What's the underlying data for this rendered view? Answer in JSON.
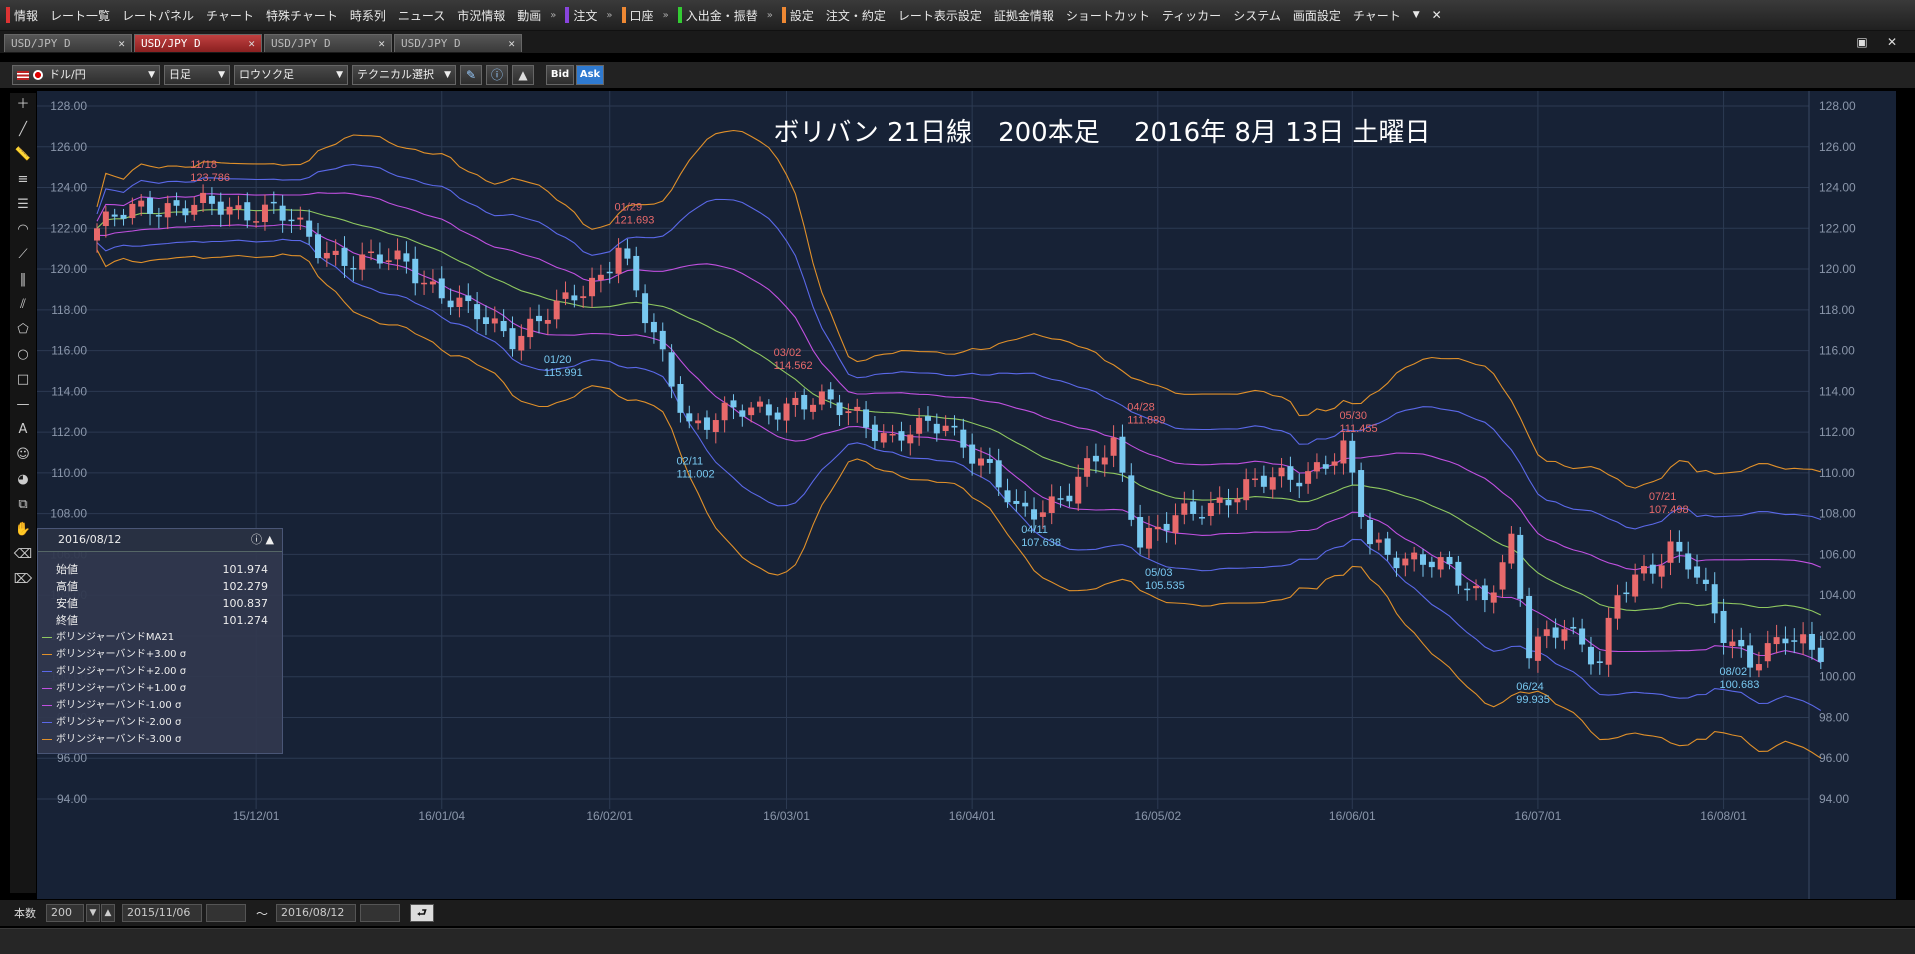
{
  "menubar": {
    "items": [
      {
        "label": "情報",
        "bar": "#d33"
      },
      {
        "label": "レート一覧"
      },
      {
        "label": "レートパネル"
      },
      {
        "label": "チャート"
      },
      {
        "label": "特殊チャート"
      },
      {
        "label": "時系列"
      },
      {
        "label": "ニュース"
      },
      {
        "label": "市況情報"
      },
      {
        "label": "動画"
      },
      {
        "label": "注文",
        "bar": "#84d",
        "sep": true
      },
      {
        "label": "口座",
        "bar": "#e83",
        "sep": true
      },
      {
        "label": "入出金・振替",
        "bar": "#3c3",
        "sep": true
      },
      {
        "label": "設定",
        "bar": "#e83",
        "sep": true
      },
      {
        "label": "注文・約定"
      },
      {
        "label": "レート表示設定"
      },
      {
        "label": "証拠金情報"
      },
      {
        "label": "ショートカット"
      },
      {
        "label": "ティッカー"
      },
      {
        "label": "システム"
      },
      {
        "label": "画面設定"
      },
      {
        "label": "チャート"
      }
    ],
    "dropdown_glyph": "▼",
    "close_glyph": "✕"
  },
  "tabs": [
    {
      "label": "USD/JPY D",
      "active": false
    },
    {
      "label": "USD/JPY D",
      "active": true
    },
    {
      "label": "USD/JPY D",
      "active": false
    },
    {
      "label": "USD/JPY D",
      "active": false
    }
  ],
  "tab_close": "✕",
  "window_buttons": {
    "restore": "▣",
    "close": "✕"
  },
  "toolbar": {
    "pair": "ドル/円",
    "period": "日足",
    "chart_type": "ロウソク足",
    "technical": "テクニカル選択",
    "bid": "Bid",
    "ask": "Ask"
  },
  "bottom": {
    "count_label": "本数",
    "count_value": "200",
    "from_date": "2015/11/06",
    "tilde": "〜",
    "to_date": "2016/08/12",
    "back_glyph": "⮐"
  },
  "info_panel": {
    "date": "2016/08/12",
    "rows": [
      {
        "label": "始値",
        "value": "101.974"
      },
      {
        "label": "高値",
        "value": "102.279"
      },
      {
        "label": "安値",
        "value": "100.837"
      },
      {
        "label": "終値",
        "value": "101.274"
      }
    ],
    "legend": [
      {
        "label": "ボリンジャーバンドMA21",
        "color": "#8fc860"
      },
      {
        "label": "ボリンジャーバンド+3.00 σ",
        "color": "#e0902a"
      },
      {
        "label": "ボリンジャーバンド+2.00 σ",
        "color": "#5a68e8"
      },
      {
        "label": "ボリンジャーバンド+1.00 σ",
        "color": "#c050e0"
      },
      {
        "label": "ボリンジャーバンド-1.00 σ",
        "color": "#c050e0"
      },
      {
        "label": "ボリンジャーバンド-2.00 σ",
        "color": "#5a68e8"
      },
      {
        "label": "ボリンジャーバンド-3.00 σ",
        "color": "#e0902a"
      }
    ]
  },
  "colors": {
    "chart_bg": "#172236",
    "grid": "#2c3a52",
    "up": "#e8696b",
    "down": "#78c8f0",
    "ma": "#8fc860",
    "band3": "#e0902a",
    "band2": "#5a68e8",
    "band1": "#c050e0",
    "axis_text": "#8a96aa",
    "annot_high": "#e8696b",
    "annot_low": "#78c8f0"
  },
  "chart_data": {
    "type": "candlestick",
    "title": "ボリバン 21日線　200本足　 2016年 8月 13日 土曜日",
    "ylim": [
      94,
      128
    ],
    "yticks": [
      "94.00",
      "96.00",
      "98.00",
      "100.00",
      "102.00",
      "104.00",
      "106.00",
      "108.00",
      "110.00",
      "112.00",
      "114.00",
      "116.00",
      "118.00",
      "120.00",
      "122.00",
      "124.00",
      "126.00",
      "128.00"
    ],
    "xtick_labels": [
      "15/12/01",
      "16/01/04",
      "16/02/01",
      "16/03/01",
      "16/04/01",
      "16/05/02",
      "16/06/01",
      "16/07/01",
      "16/08/01"
    ],
    "xtick_index": [
      18,
      39,
      58,
      78,
      99,
      120,
      142,
      163,
      184
    ],
    "bar_count": 200,
    "close_keyframes": [
      [
        0,
        122.0
      ],
      [
        6,
        123.2
      ],
      [
        15,
        122.9
      ],
      [
        20,
        123.0
      ],
      [
        25,
        121.0
      ],
      [
        30,
        120.4
      ],
      [
        35,
        120.3
      ],
      [
        42,
        117.8
      ],
      [
        47,
        116.8
      ],
      [
        53,
        118.2
      ],
      [
        57,
        119.8
      ],
      [
        59,
        121.3
      ],
      [
        62,
        117.5
      ],
      [
        67,
        112.5
      ],
      [
        71,
        112.8
      ],
      [
        74,
        113.0
      ],
      [
        79,
        113.5
      ],
      [
        86,
        113.0
      ],
      [
        90,
        111.5
      ],
      [
        96,
        112.6
      ],
      [
        100,
        110.5
      ],
      [
        104,
        108.0
      ],
      [
        110,
        109.0
      ],
      [
        115,
        111.5
      ],
      [
        118,
        106.8
      ],
      [
        124,
        108.0
      ],
      [
        128,
        109.0
      ],
      [
        135,
        109.8
      ],
      [
        141,
        111.0
      ],
      [
        144,
        106.5
      ],
      [
        151,
        105.5
      ],
      [
        157,
        104.0
      ],
      [
        160,
        106.5
      ],
      [
        162,
        101.0
      ],
      [
        166,
        102.8
      ],
      [
        170,
        100.6
      ],
      [
        172,
        103.8
      ],
      [
        178,
        106.5
      ],
      [
        180,
        105.6
      ],
      [
        184,
        102.0
      ],
      [
        187,
        101.0
      ],
      [
        191,
        101.8
      ],
      [
        194,
        101.2
      ],
      [
        195,
        101.27
      ]
    ],
    "annotations": [
      {
        "kind": "high",
        "idx": 11,
        "date": "11/18",
        "value": "123.786"
      },
      {
        "kind": "low",
        "idx": 51,
        "date": "01/20",
        "value": "115.991"
      },
      {
        "kind": "high",
        "idx": 59,
        "date": "01/29",
        "value": "121.693"
      },
      {
        "kind": "low",
        "idx": 66,
        "date": "02/11",
        "value": "111.002"
      },
      {
        "kind": "high",
        "idx": 77,
        "date": "03/02",
        "value": "114.562"
      },
      {
        "kind": "low",
        "idx": 105,
        "date": "04/11",
        "value": "107.638"
      },
      {
        "kind": "high",
        "idx": 117,
        "date": "04/28",
        "value": "111.889"
      },
      {
        "kind": "low",
        "idx": 119,
        "date": "05/03",
        "value": "105.535"
      },
      {
        "kind": "high",
        "idx": 141,
        "date": "05/30",
        "value": "111.455"
      },
      {
        "kind": "low",
        "idx": 161,
        "date": "06/24",
        "value": "99.935"
      },
      {
        "kind": "high",
        "idx": 176,
        "date": "07/21",
        "value": "107.498"
      },
      {
        "kind": "low",
        "idx": 184,
        "date": "08/02",
        "value": "100.683"
      }
    ],
    "bands": [
      "MA21",
      "+3.00σ",
      "+2.00σ",
      "+1.00σ",
      "-1.00σ",
      "-2.00σ",
      "-3.00σ"
    ]
  }
}
